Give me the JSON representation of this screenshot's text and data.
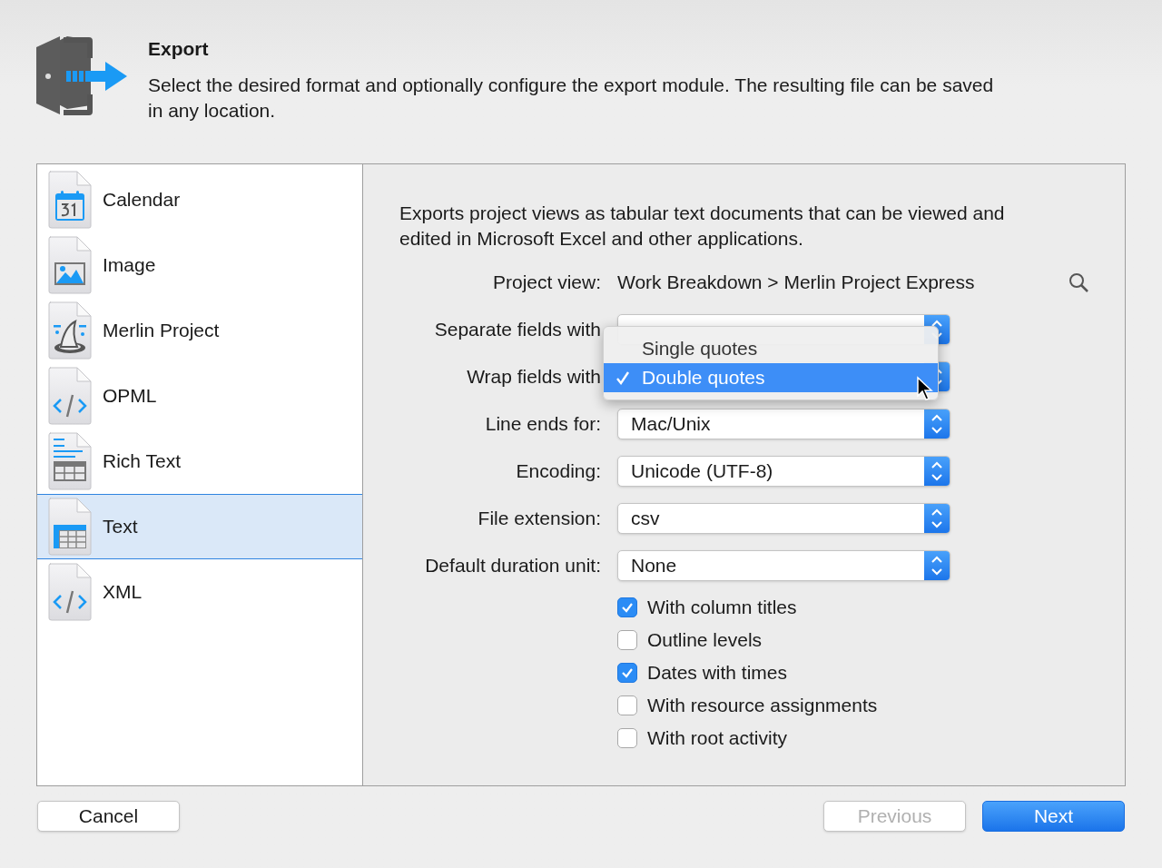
{
  "header": {
    "title": "Export",
    "description": "Select the desired format and optionally configure the export module. The resulting file can be saved in any location."
  },
  "sidebar": {
    "items": [
      {
        "label": "Calendar",
        "kind": "calendar",
        "selected": false
      },
      {
        "label": "Image",
        "kind": "image",
        "selected": false
      },
      {
        "label": "Merlin Project",
        "kind": "hat",
        "selected": false
      },
      {
        "label": "OPML",
        "kind": "code",
        "selected": false
      },
      {
        "label": "Rich Text",
        "kind": "richtext",
        "selected": false
      },
      {
        "label": "Text",
        "kind": "table",
        "selected": true
      },
      {
        "label": "XML",
        "kind": "code",
        "selected": false
      }
    ]
  },
  "panel": {
    "description": "Exports project views as tabular text documents that can be viewed and edited in Microsoft Excel and other applications.",
    "project_view": {
      "label": "Project view:",
      "value": "Work Breakdown > Merlin Project Express"
    },
    "fields": [
      {
        "label": "Separate fields with",
        "kind": "popup"
      },
      {
        "label": "Wrap fields with",
        "kind": "popup"
      },
      {
        "label": "Line ends for:",
        "kind": "popup",
        "value": "Mac/Unix"
      },
      {
        "label": "Encoding:",
        "kind": "popup",
        "value": "Unicode (UTF-8)"
      },
      {
        "label": "File extension:",
        "kind": "popup",
        "value": "csv"
      },
      {
        "label": "Default duration unit:",
        "kind": "popup",
        "value": "None"
      }
    ],
    "options": [
      {
        "label": "With column titles",
        "checked": true
      },
      {
        "label": "Outline levels",
        "checked": false
      },
      {
        "label": "Dates with times",
        "checked": true
      },
      {
        "label": "With resource assignments",
        "checked": false
      },
      {
        "label": "With root activity",
        "checked": false
      }
    ],
    "menu": {
      "items": [
        {
          "label": "Single quotes",
          "selected": false
        },
        {
          "label": "Double quotes",
          "selected": true
        }
      ]
    }
  },
  "buttons": [
    {
      "label": "Cancel",
      "kind": "normal",
      "disabled": false
    },
    {
      "label": "Previous",
      "kind": "normal",
      "disabled": true
    },
    {
      "label": "Next",
      "kind": "default",
      "disabled": false
    }
  ]
}
